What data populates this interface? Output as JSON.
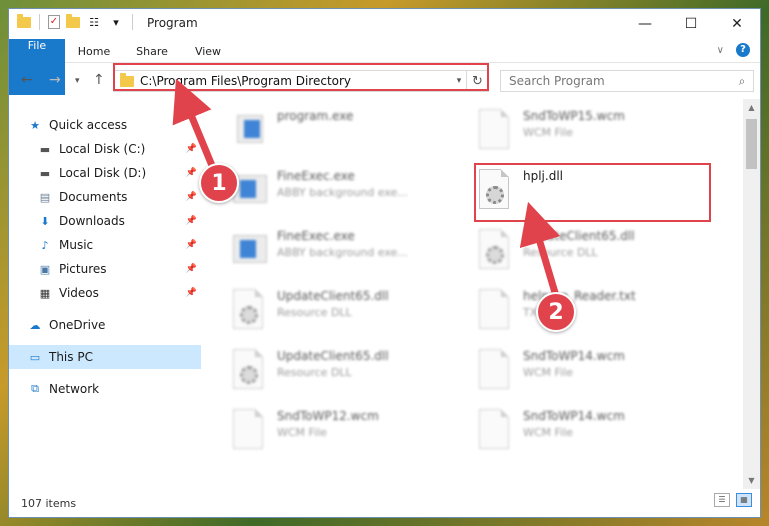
{
  "window": {
    "title": "Program"
  },
  "ribbon": {
    "tabs": [
      "File",
      "Home",
      "Share",
      "View"
    ]
  },
  "address": {
    "path": "C:\\Program Files\\Program Directory"
  },
  "search": {
    "placeholder": "Search Program"
  },
  "sidebar": {
    "items": [
      {
        "label": "Quick access",
        "icon": "star-icon"
      },
      {
        "label": "Local Disk (C:)",
        "icon": "drive-icon",
        "pinned": true
      },
      {
        "label": "Local Disk (D:)",
        "icon": "drive-icon",
        "pinned": true
      },
      {
        "label": "Documents",
        "icon": "documents-icon",
        "pinned": true
      },
      {
        "label": "Downloads",
        "icon": "download-icon",
        "pinned": true
      },
      {
        "label": "Music",
        "icon": "music-icon",
        "pinned": true
      },
      {
        "label": "Pictures",
        "icon": "pictures-icon",
        "pinned": true
      },
      {
        "label": "Videos",
        "icon": "videos-icon",
        "pinned": true
      },
      {
        "label": "OneDrive",
        "icon": "cloud-icon"
      },
      {
        "label": "This PC",
        "icon": "computer-icon",
        "selected": true
      },
      {
        "label": "Network",
        "icon": "network-icon"
      }
    ]
  },
  "files": [
    {
      "name": "program.exe",
      "desc": "",
      "type": "exe-setup"
    },
    {
      "name": "SndToWP15.wcm",
      "desc": "WCM File",
      "type": "doc"
    },
    {
      "name": "FineExec.exe",
      "desc": "ABBY background exe...",
      "type": "exe"
    },
    {
      "name": "hplj.dll",
      "desc": "",
      "type": "dll"
    },
    {
      "name": "FineExec.exe",
      "desc": "ABBY background exe...",
      "type": "exe"
    },
    {
      "name": "UpdateClient65.dll",
      "desc": "Resource DLL",
      "type": "dll"
    },
    {
      "name": "UpdateClient65.dll",
      "desc": "Resource DLL",
      "type": "dll"
    },
    {
      "name": "helpme_Reader.txt",
      "desc": "TXT",
      "type": "doc"
    },
    {
      "name": "UpdateClient65.dll",
      "desc": "Resource DLL",
      "type": "dll"
    },
    {
      "name": "SndToWP14.wcm",
      "desc": "WCM File",
      "type": "doc"
    },
    {
      "name": "SndToWP12.wcm",
      "desc": "WCM File",
      "type": "doc"
    },
    {
      "name": "SndToWP14.wcm",
      "desc": "WCM File",
      "type": "doc"
    }
  ],
  "status": {
    "items": "107 items"
  },
  "callouts": {
    "one": "1",
    "two": "2"
  },
  "colors": {
    "accent": "#1979ca",
    "highlight": "#e0434b",
    "selected": "#cce8ff"
  }
}
